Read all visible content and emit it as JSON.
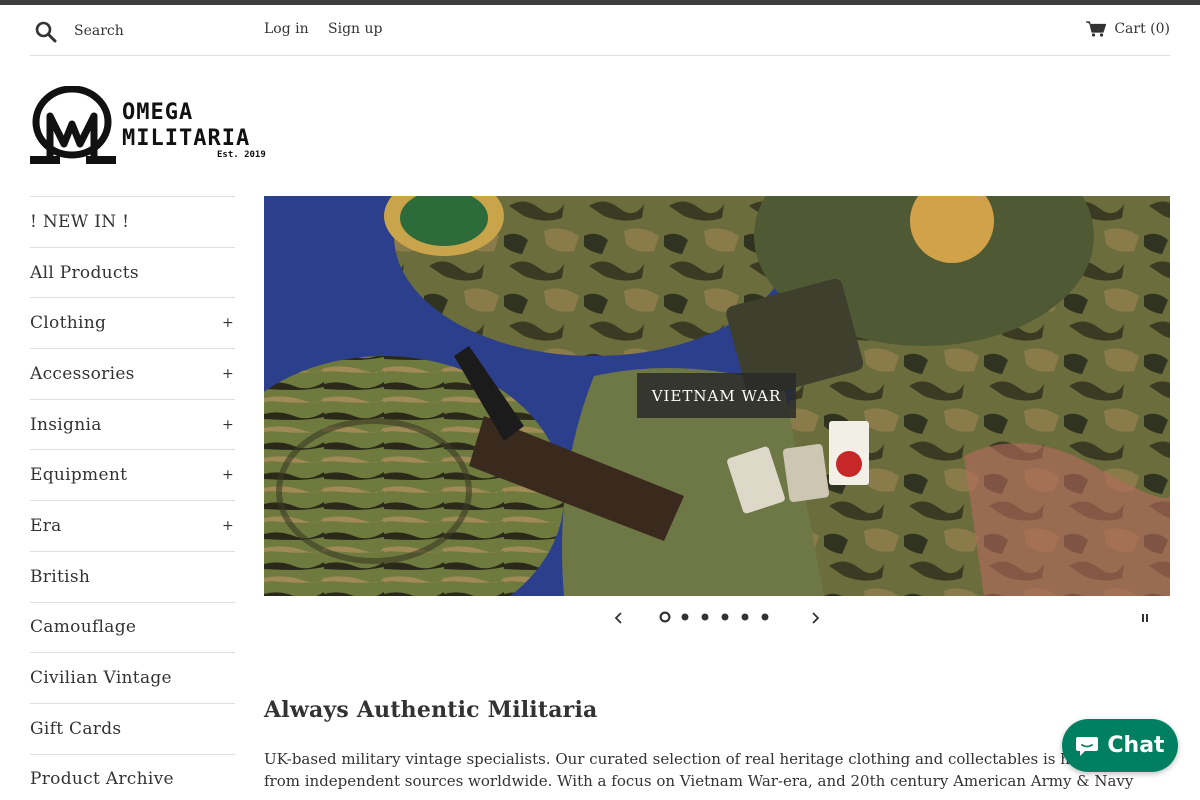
{
  "header": {
    "search_placeholder": "Search",
    "login_label": "Log in",
    "signup_label": "Sign up",
    "cart_label": "Cart (0)",
    "icons": {
      "search": "search-icon",
      "cart": "cart-icon"
    }
  },
  "logo": {
    "line1": "OMEGA",
    "line2": "MILITARIA",
    "established": "Est. 2019"
  },
  "sidebar": {
    "items": [
      {
        "label": "! NEW IN !",
        "expandable": false
      },
      {
        "label": "All Products",
        "expandable": false
      },
      {
        "label": "Clothing",
        "expandable": true
      },
      {
        "label": "Accessories",
        "expandable": true
      },
      {
        "label": "Insignia",
        "expandable": true
      },
      {
        "label": "Equipment",
        "expandable": true
      },
      {
        "label": "Era",
        "expandable": true
      },
      {
        "label": "British",
        "expandable": false
      },
      {
        "label": "Camouflage",
        "expandable": false
      },
      {
        "label": "Civilian Vintage",
        "expandable": false
      },
      {
        "label": "Gift Cards",
        "expandable": false
      },
      {
        "label": "Product Archive",
        "expandable": false
      }
    ],
    "expand_symbol": "+"
  },
  "hero": {
    "button_label": "VIETNAM WAR",
    "slide_count": 6,
    "active_slide": 1
  },
  "content": {
    "heading": "Always Authentic Militaria",
    "description": "UK-based military vintage specialists. Our curated selection of real heritage clothing and collectables is hand-picked from independent sources worldwide. With a focus on Vietnam War-era, and 20th century American Army & Navy"
  },
  "chat": {
    "label": "Chat"
  },
  "colors": {
    "topbar": "#3d3d3d",
    "chat_bg": "#008060",
    "text": "#333333"
  }
}
